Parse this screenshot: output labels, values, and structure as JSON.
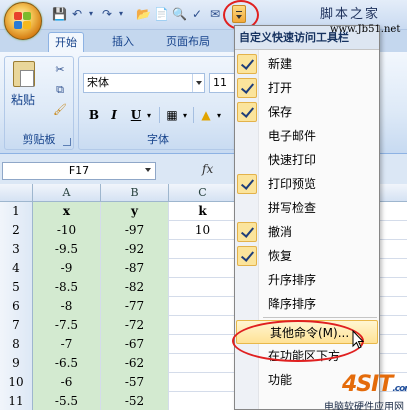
{
  "site_header": "脚本之家",
  "site_url": "www.Jb51.net",
  "ribbon": {
    "tabs": [
      {
        "label": "开始",
        "active": true
      },
      {
        "label": "插入",
        "active": false
      },
      {
        "label": "页面布局",
        "active": false
      }
    ],
    "clipboard": {
      "paste_label": "粘贴",
      "group_label": "剪贴板"
    },
    "font": {
      "font_name": "宋体",
      "font_size": "11",
      "group_label": "字体"
    }
  },
  "formula_bar": {
    "name_box": "F17",
    "fx": "fx"
  },
  "sheet": {
    "columns": [
      "A",
      "B",
      "C"
    ],
    "rows": [
      {
        "num": "1",
        "cells": [
          "x",
          "y",
          "k"
        ]
      },
      {
        "num": "2",
        "cells": [
          "-10",
          "-97",
          "10"
        ]
      },
      {
        "num": "3",
        "cells": [
          "-9.5",
          "-92",
          ""
        ]
      },
      {
        "num": "4",
        "cells": [
          "-9",
          "-87",
          ""
        ]
      },
      {
        "num": "5",
        "cells": [
          "-8.5",
          "-82",
          ""
        ]
      },
      {
        "num": "6",
        "cells": [
          "-8",
          "-77",
          ""
        ]
      },
      {
        "num": "7",
        "cells": [
          "-7.5",
          "-72",
          ""
        ]
      },
      {
        "num": "8",
        "cells": [
          "-7",
          "-67",
          ""
        ]
      },
      {
        "num": "9",
        "cells": [
          "-6.5",
          "-62",
          ""
        ]
      },
      {
        "num": "10",
        "cells": [
          "-6",
          "-57",
          ""
        ]
      },
      {
        "num": "11",
        "cells": [
          "-5.5",
          "-52",
          ""
        ]
      },
      {
        "num": "12",
        "cells": [
          "-5",
          "-47",
          ""
        ]
      }
    ]
  },
  "qat_menu": {
    "title": "自定义快速访问工具栏",
    "items": [
      {
        "label": "新建",
        "checked": true
      },
      {
        "label": "打开",
        "checked": true
      },
      {
        "label": "保存",
        "checked": true
      },
      {
        "label": "电子邮件",
        "checked": false
      },
      {
        "label": "快速打印",
        "checked": false
      },
      {
        "label": "打印预览",
        "checked": true
      },
      {
        "label": "拼写检查",
        "checked": false
      },
      {
        "label": "撤消",
        "checked": true
      },
      {
        "label": "恢复",
        "checked": true
      },
      {
        "label": "升序排序",
        "checked": false
      },
      {
        "label": "降序排序",
        "checked": false
      },
      {
        "label": "其他命令(M)...",
        "checked": false,
        "highlighted": true
      },
      {
        "label": "在功能区下方",
        "checked": false
      },
      {
        "label": "功能",
        "checked": false
      }
    ]
  },
  "watermark": {
    "logo_main": "4SIT",
    "logo_suffix": ".com",
    "subtitle": "电脑软硬件应用网"
  },
  "colors": {
    "accent_red": "#e02020",
    "cell_green": "#d3ead0",
    "ribbon_blue": "#dbe7f5"
  }
}
